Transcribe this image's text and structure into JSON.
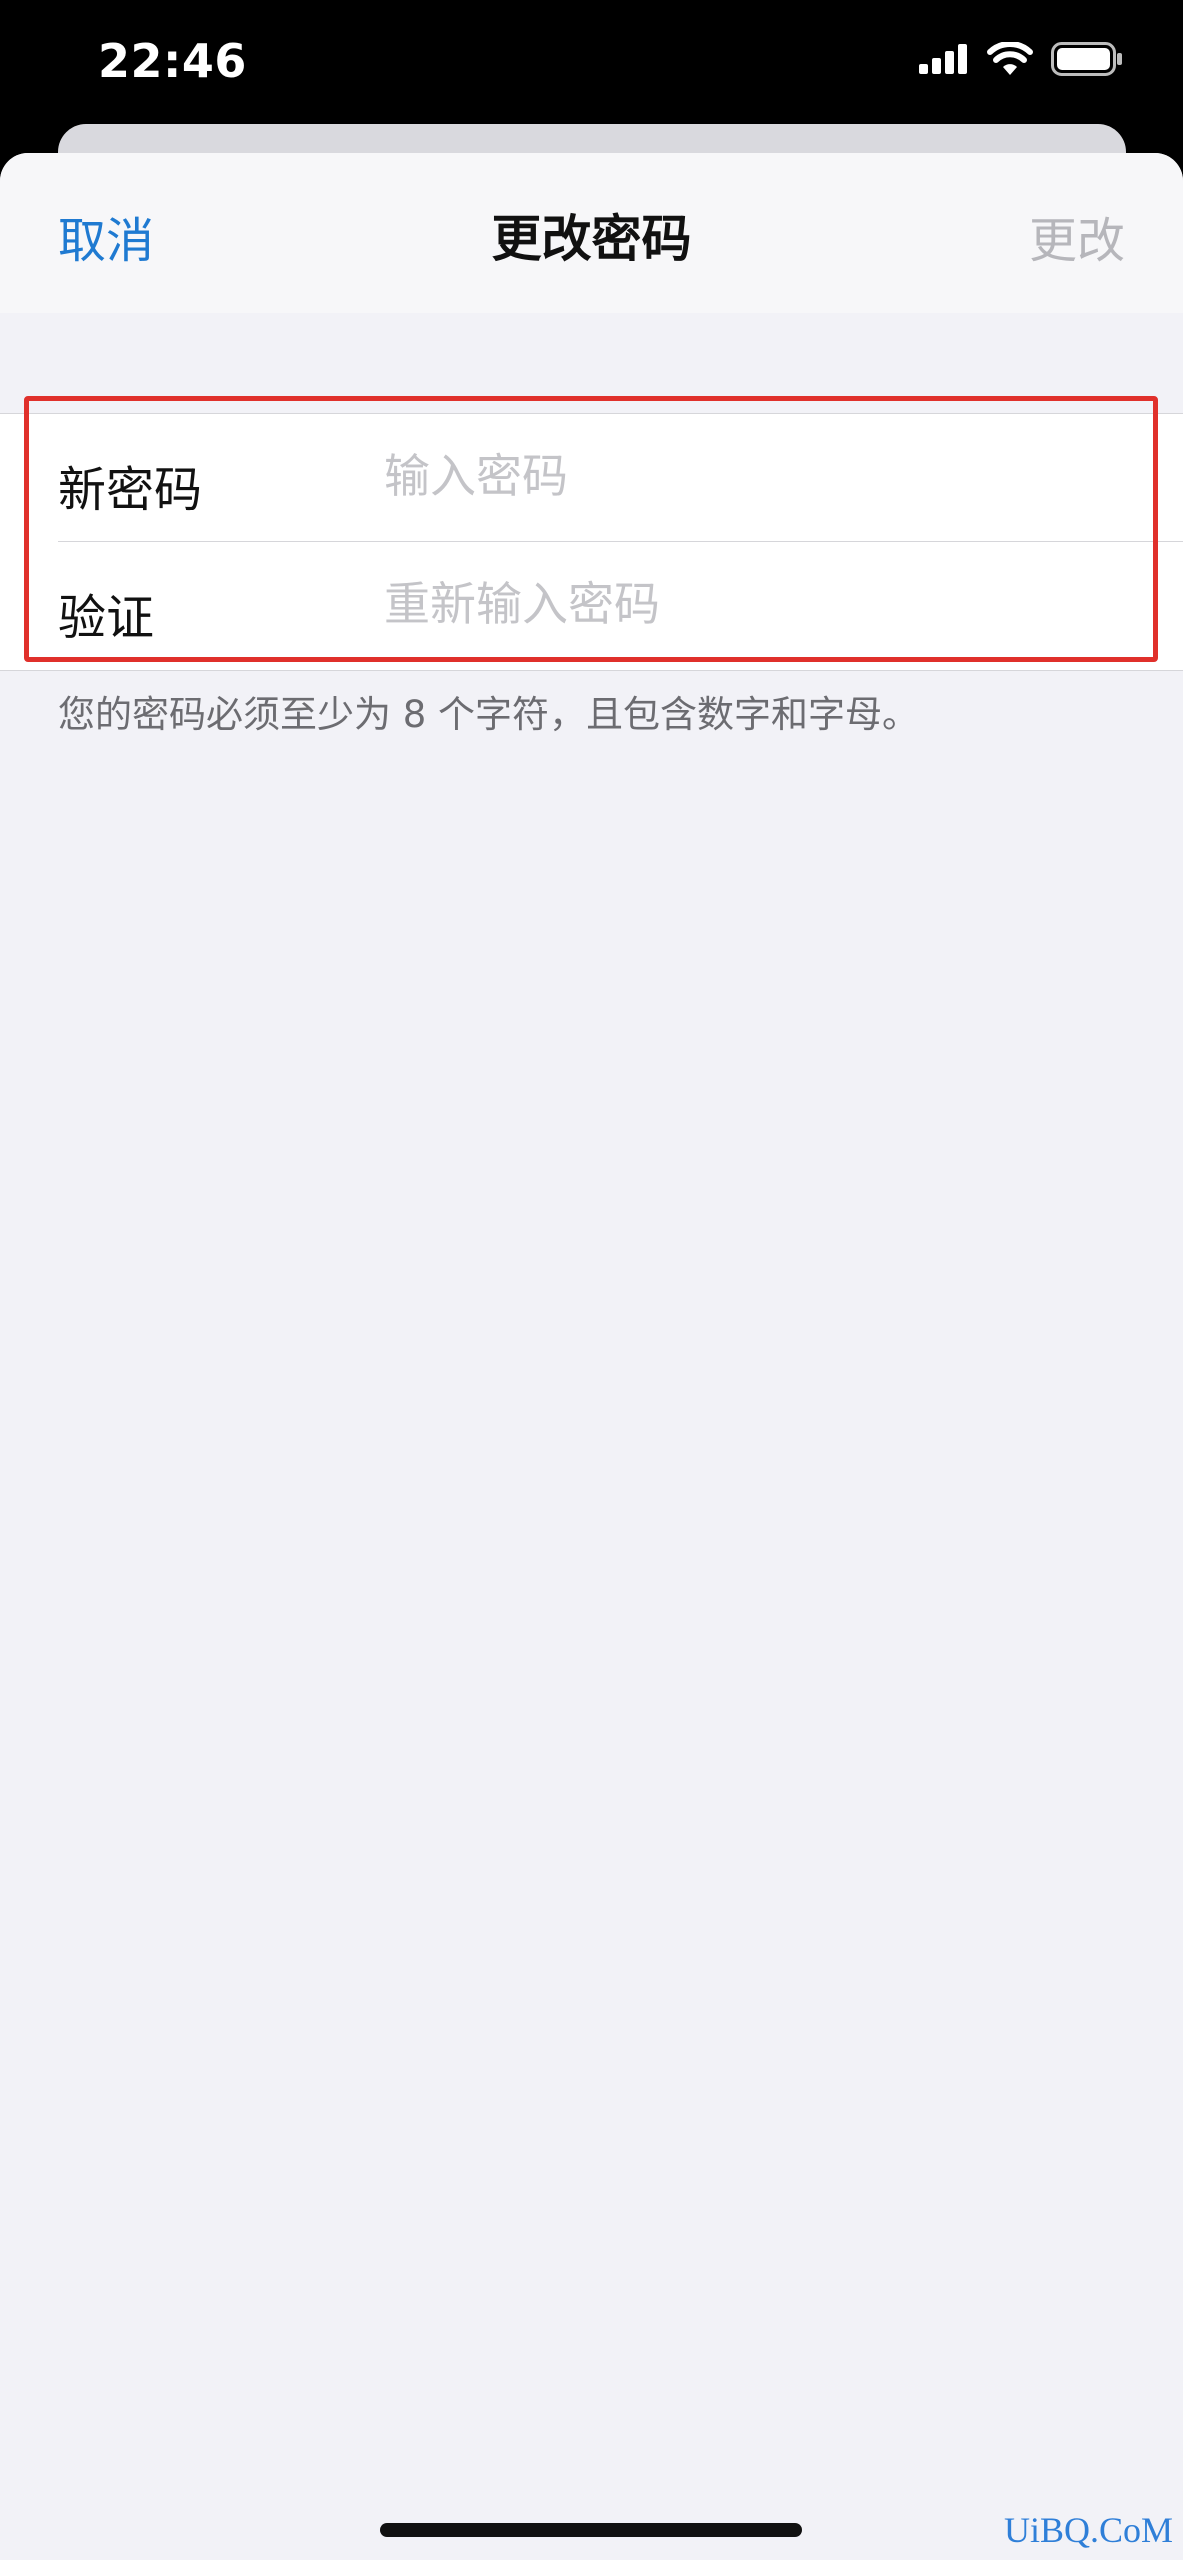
{
  "status_bar": {
    "time": "22:46"
  },
  "nav": {
    "cancel_label": "取消",
    "title": "更改密码",
    "confirm_label": "更改"
  },
  "form": {
    "new_password": {
      "label": "新密码",
      "placeholder": "输入密码",
      "value": ""
    },
    "verify": {
      "label": "验证",
      "placeholder": "重新输入密码",
      "value": ""
    }
  },
  "hint": "您的密码必须至少为 8 个字符，且包含数字和字母。",
  "watermark": "UiBQ.CoM",
  "colors": {
    "accent": "#1f7ad1",
    "disabled": "#b6b6bb",
    "highlight": "#e0302b",
    "background": "#f2f2f7"
  },
  "icons": [
    "cellular-signal-icon",
    "wifi-icon",
    "battery-icon"
  ]
}
